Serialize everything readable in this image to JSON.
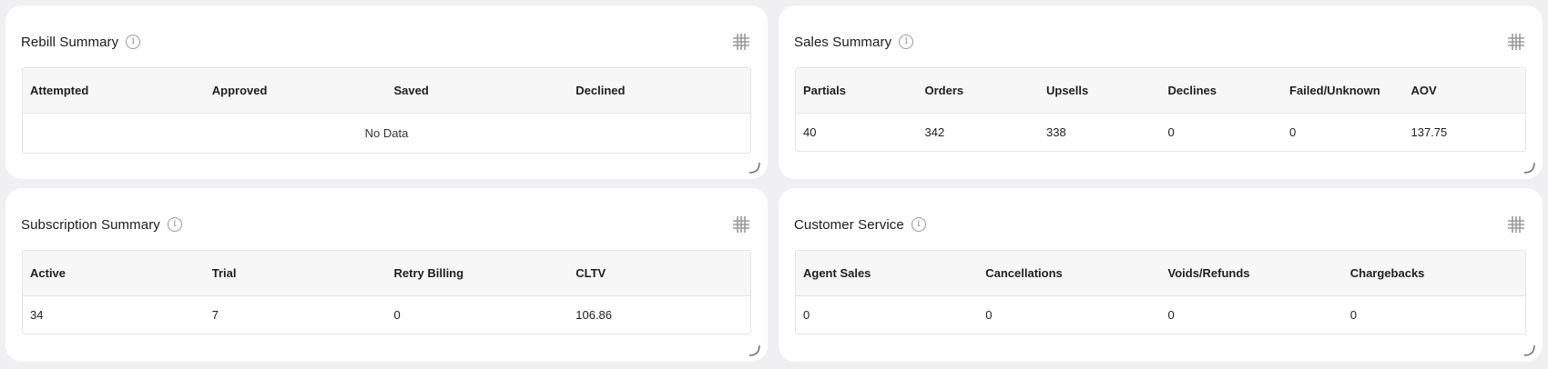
{
  "cards": {
    "rebill": {
      "title": "Rebill Summary",
      "columns": [
        "Attempted",
        "Approved",
        "Saved",
        "Declined"
      ],
      "empty_text": "No Data"
    },
    "sales": {
      "title": "Sales Summary",
      "columns": [
        "Partials",
        "Orders",
        "Upsells",
        "Declines",
        "Failed/Unknown",
        "AOV"
      ],
      "row": [
        "40",
        "342",
        "338",
        "0",
        "0",
        "137.75"
      ]
    },
    "subscription": {
      "title": "Subscription Summary",
      "columns": [
        "Active",
        "Trial",
        "Retry Billing",
        "CLTV"
      ],
      "row": [
        "34",
        "7",
        "0",
        "106.86"
      ]
    },
    "customer_service": {
      "title": "Customer Service",
      "columns": [
        "Agent Sales",
        "Cancellations",
        "Voids/Refunds",
        "Chargebacks"
      ],
      "row": [
        "0",
        "0",
        "0",
        "0"
      ]
    }
  },
  "icons": {
    "info": "info-icon",
    "grid": "grid-icon",
    "resize": "resize-handle-icon"
  },
  "colors": {
    "background": "#f0f0f2",
    "card": "#ffffff",
    "table_header": "#f7f7f8",
    "border": "#e4e4e6",
    "icon": "#9a9a9a"
  }
}
